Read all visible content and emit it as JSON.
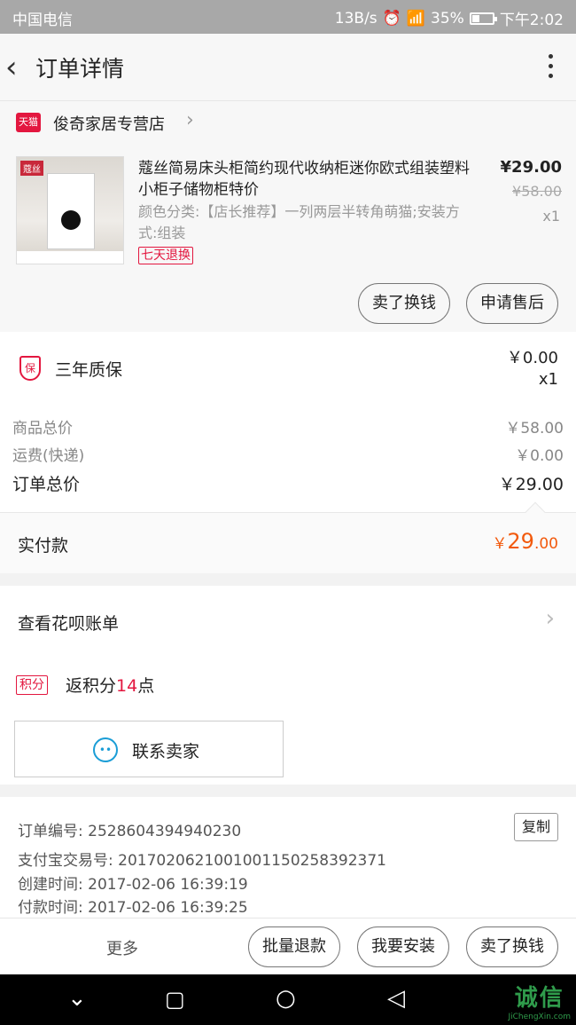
{
  "status_bar": {
    "carrier": "中国电信",
    "speed": "13B/s",
    "battery": "35%",
    "time": "下午2:02"
  },
  "header": {
    "title": "订单详情"
  },
  "shop": {
    "badge": "天猫",
    "name": "俊奇家居专营店"
  },
  "product": {
    "title": "蔻丝简易床头柜简约现代收纳柜迷你欧式组装塑料小柜子储物柜特价",
    "sku": "颜色分类:【店长推荐】一列两层半转角萌猫;安装方式:组装",
    "return_badge": "七天退换",
    "price": "¥29.00",
    "original_price": "¥58.00",
    "quantity": "x1",
    "thumb_logo": "蔻丝",
    "buttons": {
      "trade_in": "卖了换钱",
      "after_sale": "申请售后"
    }
  },
  "warranty": {
    "icon_text": "保",
    "label": "三年质保",
    "price": "￥0.00",
    "quantity": "x1"
  },
  "summary": {
    "goods_total_label": "商品总价",
    "goods_total": "￥58.00",
    "shipping_label": "运费(快递)",
    "shipping": "￥0.00",
    "order_total_label": "订单总价",
    "order_total": "￥29.00"
  },
  "paid": {
    "label": "实付款",
    "currency": "￥",
    "integer": "29",
    "decimal": ".00"
  },
  "huabei": {
    "label": "查看花呗账单"
  },
  "points": {
    "badge": "积分",
    "prefix": "返积分",
    "count": "14",
    "suffix": "点"
  },
  "contact": {
    "label": "联系卖家"
  },
  "order_info": {
    "order_no": "订单编号: 2528604394940230",
    "alipay_no": "支付宝交易号: 2017020621001001150258392371",
    "created": "创建时间: 2017-02-06 16:39:19",
    "paid_time": "付款时间: 2017-02-06 16:39:25",
    "copy": "复制"
  },
  "action_bar": {
    "more": "更多",
    "batch_refund": "批量退款",
    "install": "我要安装",
    "trade_in": "卖了换钱"
  },
  "watermark": {
    "text": "诚信",
    "url": "JiChengXin.com"
  }
}
